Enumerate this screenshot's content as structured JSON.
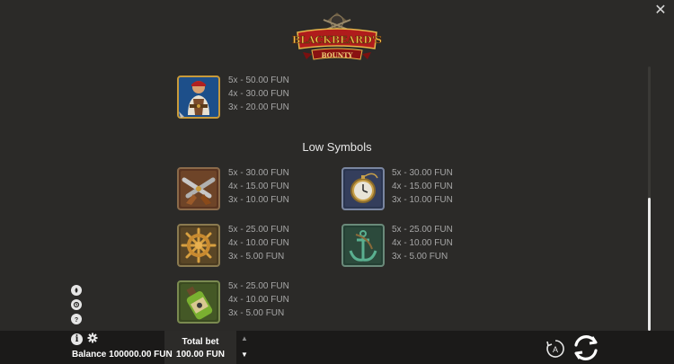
{
  "window": {
    "close_label": "✕"
  },
  "logo": {
    "line1": "BLACKBEARD'S",
    "line2": "BOUNTY"
  },
  "high_symbols": [
    {
      "icon": "pirate-symbol",
      "pays": [
        "5x - 50.00 FUN",
        "4x - 30.00 FUN",
        "3x - 20.00 FUN"
      ]
    }
  ],
  "low_section": {
    "title": "Low Symbols",
    "symbols": [
      {
        "icon": "crossed-pistols-symbol",
        "pays": [
          "5x - 30.00 FUN",
          "4x - 15.00 FUN",
          "3x - 10.00 FUN"
        ]
      },
      {
        "icon": "pocket-watch-symbol",
        "pays": [
          "5x - 30.00 FUN",
          "4x - 15.00 FUN",
          "3x - 10.00 FUN"
        ]
      },
      {
        "icon": "ship-wheel-symbol",
        "pays": [
          "5x - 25.00 FUN",
          "4x - 10.00 FUN",
          "3x - 5.00 FUN"
        ]
      },
      {
        "icon": "anchor-symbol",
        "pays": [
          "5x - 25.00 FUN",
          "4x - 10.00 FUN",
          "3x - 5.00 FUN"
        ]
      },
      {
        "icon": "rum-bottle-symbol",
        "pays": [
          "5x - 25.00 FUN",
          "4x - 10.00 FUN",
          "3x - 5.00 FUN"
        ]
      }
    ]
  },
  "side_icons": [
    "turbo-icon",
    "history-icon",
    "help-icon"
  ],
  "bottom": {
    "balance": "Balance 100000.00 FUN",
    "bet_label": "Total bet",
    "bet_value": "100.00 FUN",
    "bet_up": "▲",
    "bet_down": "▼",
    "auto_label": "A"
  },
  "colors": {
    "background": "#2b2a28",
    "bar": "#1b1a19",
    "accent_gold": "#c89a3a"
  }
}
